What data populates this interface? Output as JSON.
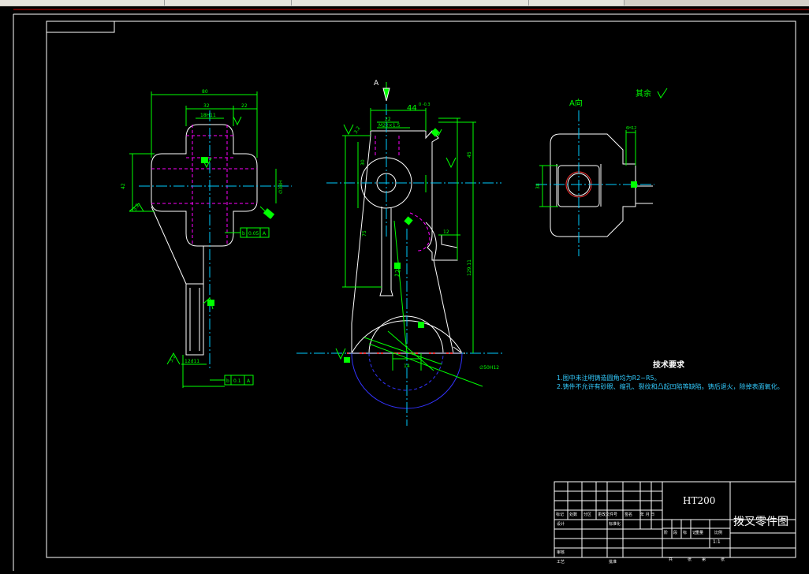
{
  "drawing": {
    "section_label_a": "A",
    "view_label": "A向",
    "surface_finish_note": "其余",
    "dims": {
      "left_overall": "80",
      "left_sub1": "32",
      "left_sub2": "22",
      "left_bore": "18H11",
      "left_height": "42",
      "left_dia": "∅38H",
      "left_slot": "12d11",
      "left_roughness_a": "3.2",
      "left_roughness_b": "3.2",
      "left_tol1": "0.05",
      "left_tol2": "0.1",
      "datum_b": "b",
      "datum_a": "A",
      "mid_top": "44",
      "mid_top_tol": "0\n-0.3",
      "mid_sub": "22",
      "mid_hole": "M22×1.5",
      "mid_h1": "30",
      "mid_h2": "75",
      "mid_h3": "45",
      "mid_h4": "129.11",
      "mid_offset": "12",
      "mid_angle": "12°",
      "mid_radius": "∅50H12",
      "mid_base": "14",
      "mid_roughness": "3.2",
      "right_w": "38",
      "right_slot": "6H12"
    }
  },
  "tech_requirements": {
    "title": "技术要求",
    "lines": [
      "1.图中未注明铸造圆角均为R2~R5。",
      "2.铸件不允许有砂眼、缩孔、裂纹和凸起凹陷等缺陷。铸后退火，除掉表面氧化。"
    ]
  },
  "title_block": {
    "material": "HT200",
    "part_name": "拨叉零件图",
    "scale": "1:1",
    "row_labels": [
      "标记",
      "处数",
      "分区",
      "更改文件号",
      "签名",
      "年 月 日"
    ],
    "left_labels": [
      "设计",
      "审核",
      "工艺"
    ],
    "mid_labels": [
      "标准化",
      "",
      "",
      "批准"
    ],
    "mid_values": [
      "",
      "",
      "",
      ""
    ],
    "stage_labels": [
      "阶",
      "段",
      "标",
      "记"
    ],
    "weight_label": "重量",
    "scale_label": "比例",
    "sheet_labels": [
      "共",
      "张",
      "第",
      "张"
    ]
  },
  "colors": {
    "border": "#ffffff",
    "dimension": "#00ff00",
    "hidden": "#ff00ff",
    "centerline": "#00ccff",
    "note": "#33ccff",
    "outline": "#ffffff",
    "red": "#ff3333"
  }
}
